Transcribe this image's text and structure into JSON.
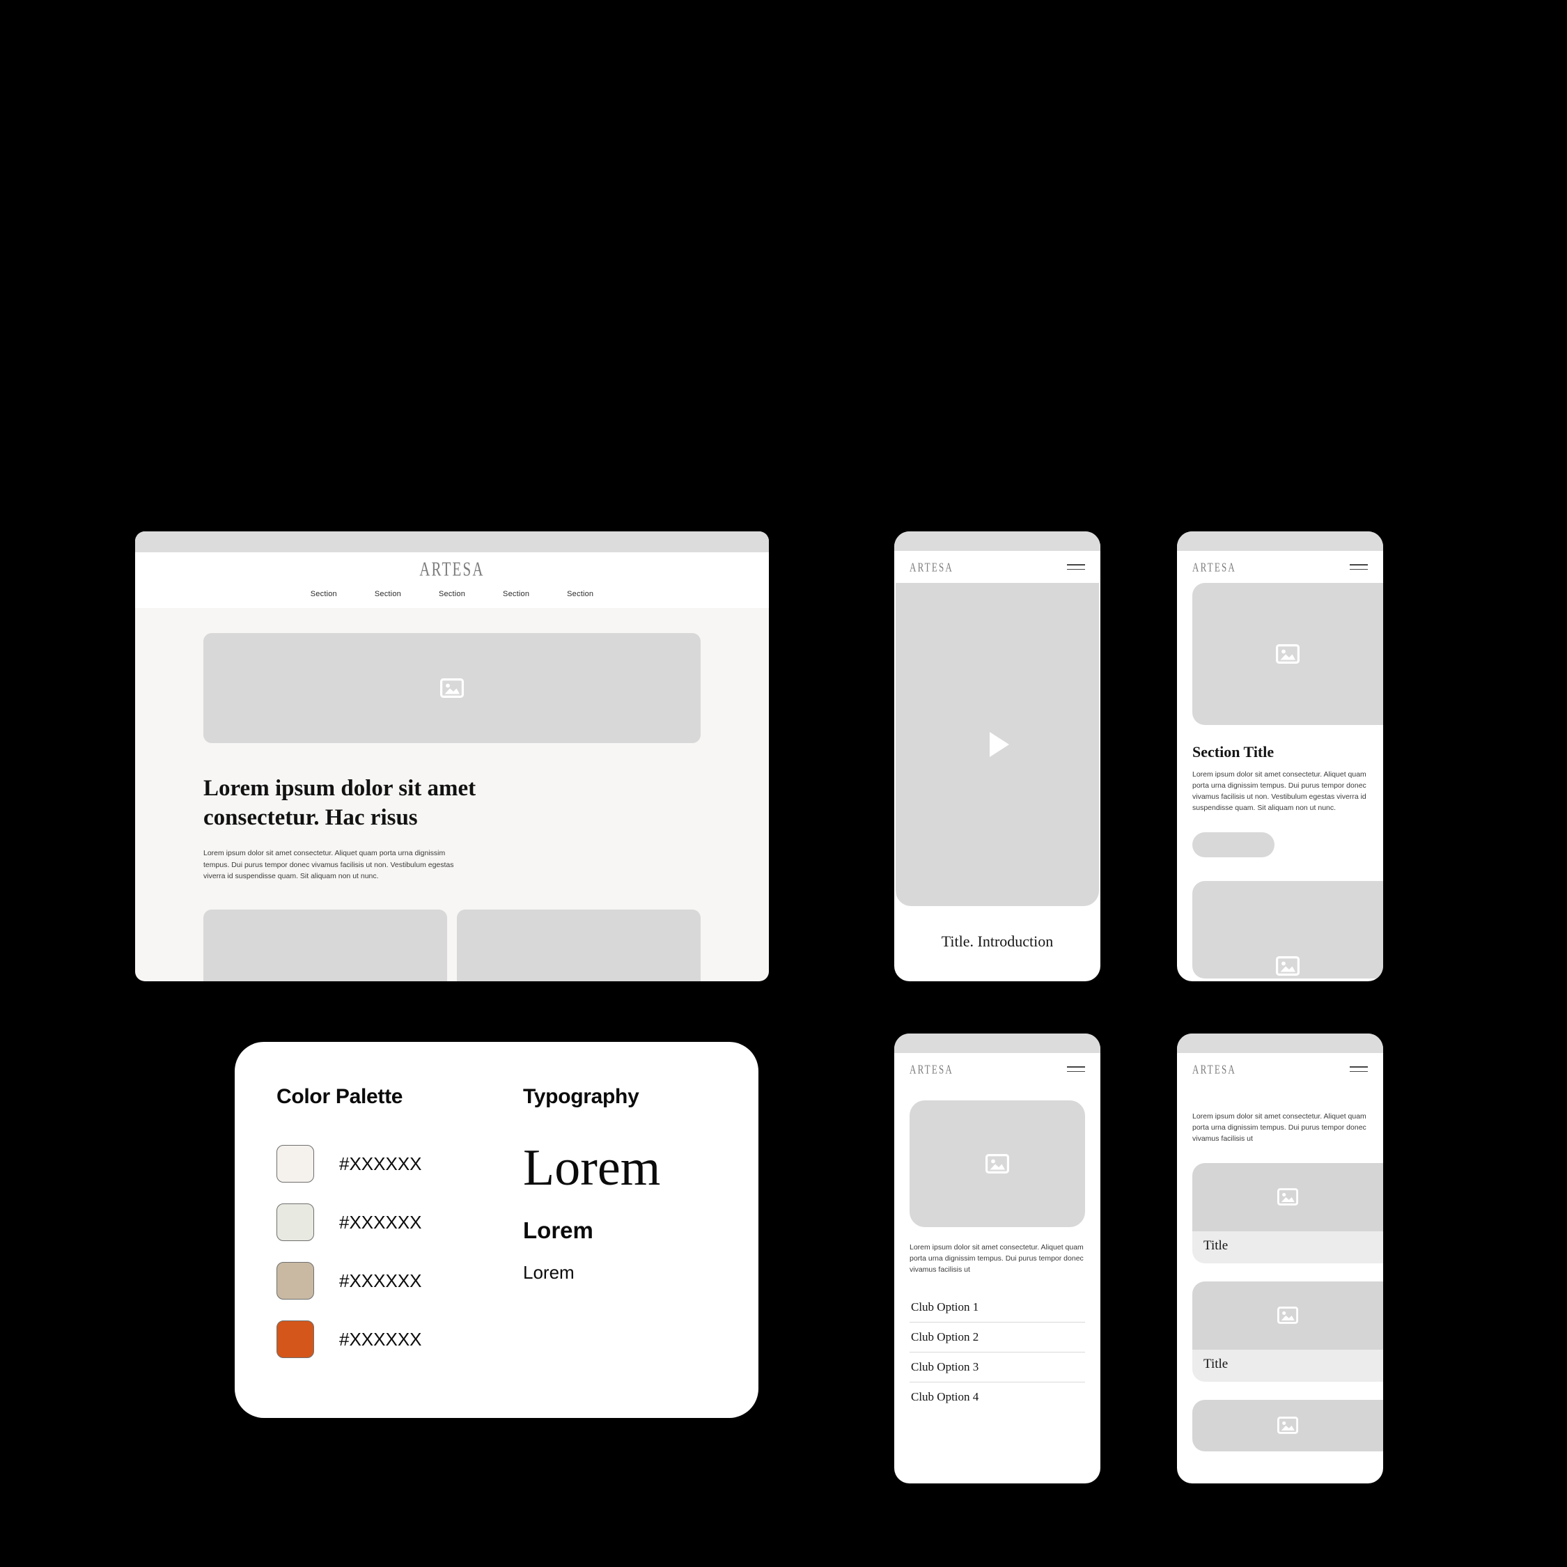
{
  "brand": {
    "name": "ARTESA"
  },
  "desktop": {
    "nav": [
      {
        "label": "Section"
      },
      {
        "label": "Section"
      },
      {
        "label": "Section"
      },
      {
        "label": "Section"
      },
      {
        "label": "Section"
      }
    ],
    "hero": {
      "heading": "Lorem ipsum dolor sit amet consectetur. Hac risus",
      "body": "Lorem ipsum dolor sit amet consectetur. Aliquet quam porta urna dignissim tempus. Dui purus tempor donec vivamus facilisis ut non. Vestibulum egestas viverra id suspendisse quam. Sit aliquam non ut nunc."
    },
    "image_placeholder_icon": "image-placeholder-icon"
  },
  "phone_video": {
    "menu_icon": "hamburger-menu-icon",
    "play_icon": "play-icon",
    "title": "Title. Introduction"
  },
  "phone_section": {
    "menu_icon": "hamburger-menu-icon",
    "section_title": "Section Title",
    "body": "Lorem ipsum dolor sit amet consectetur. Aliquet quam porta urna dignissim tempus. Dui purus tempor donec vivamus facilisis ut non. Vestibulum egestas viverra id suspendisse quam. Sit aliquam non ut nunc.",
    "cta_label": ""
  },
  "phone_club": {
    "menu_icon": "hamburger-menu-icon",
    "body": "Lorem ipsum dolor sit amet consectetur. Aliquet quam porta urna dignissim tempus. Dui purus tempor donec vivamus facilisis ut",
    "options": [
      {
        "label": "Club Option 1"
      },
      {
        "label": "Club Option 2"
      },
      {
        "label": "Club Option 3"
      },
      {
        "label": "Club Option 4"
      }
    ]
  },
  "phone_cards": {
    "menu_icon": "hamburger-menu-icon",
    "body": "Lorem ipsum dolor sit amet consectetur. Aliquet quam porta urna dignissim tempus. Dui purus tempor donec vivamus facilisis ut",
    "cards": [
      {
        "title": "Title"
      },
      {
        "title": "Title"
      },
      {
        "title": ""
      }
    ]
  },
  "style_guide": {
    "color_palette_heading": "Color Palette",
    "typography_heading": "Typography",
    "swatches": [
      {
        "code": "#XXXXXX",
        "color": "#F5F1ED"
      },
      {
        "code": "#XXXXXX",
        "color": "#E8E9E1"
      },
      {
        "code": "#XXXXXX",
        "color": "#C9B9A3"
      },
      {
        "code": "#XXXXXX",
        "color": "#D4561A"
      }
    ],
    "type_samples": {
      "display": "Lorem",
      "bold": "Lorem",
      "regular": "Lorem"
    }
  }
}
